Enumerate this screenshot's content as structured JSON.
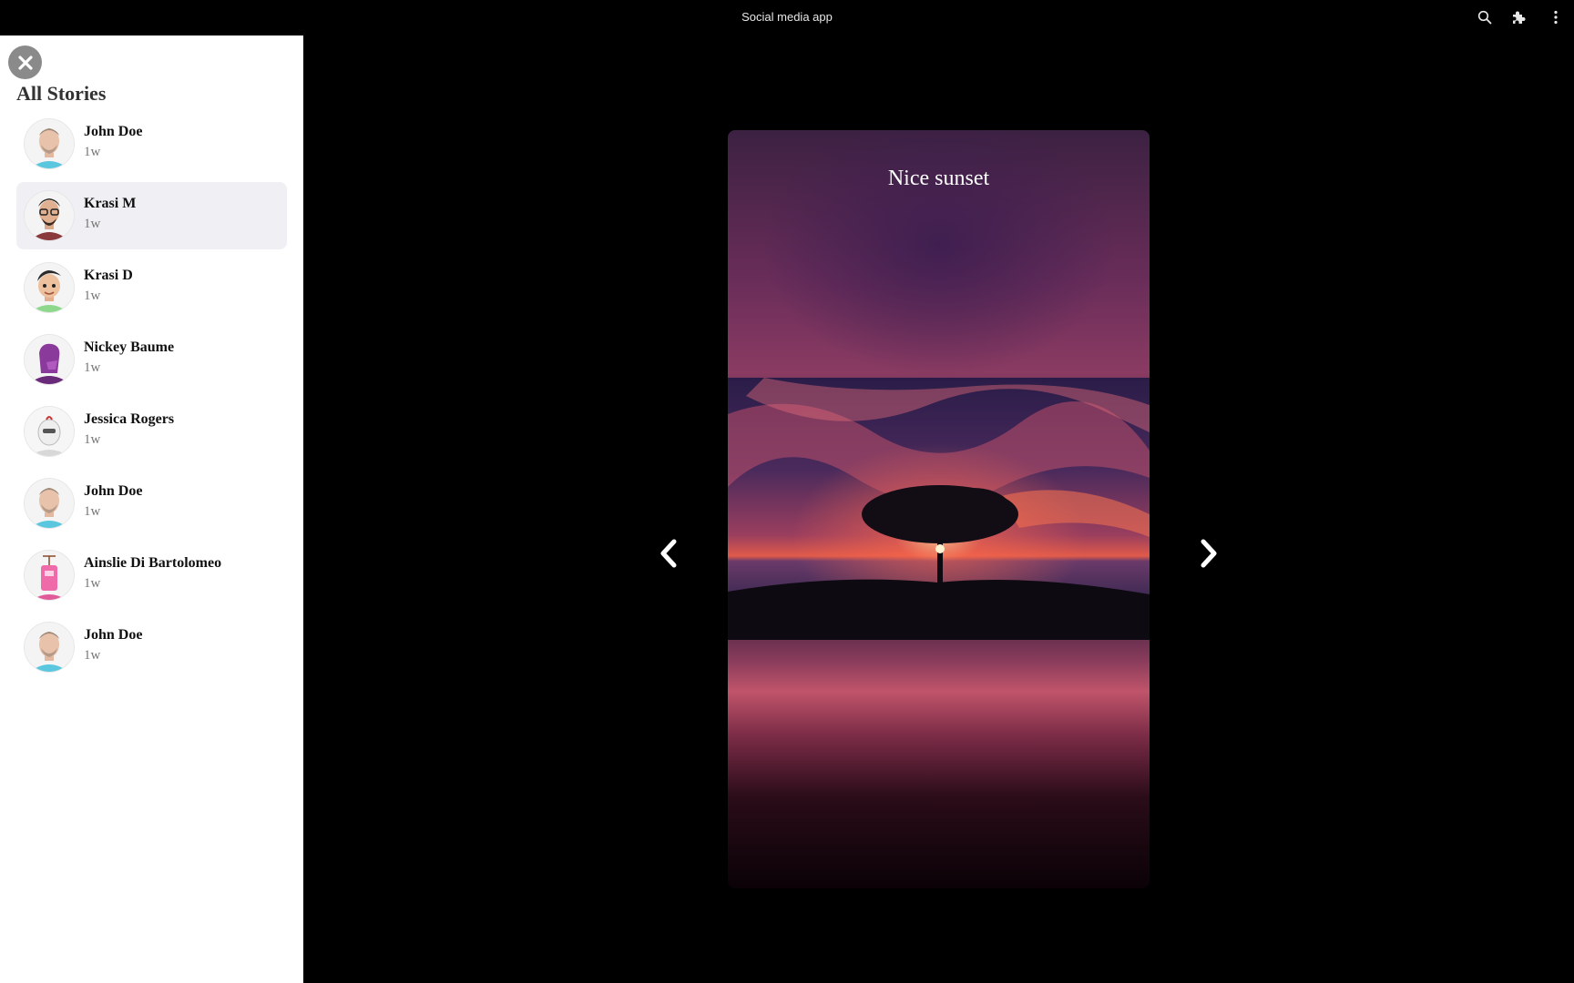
{
  "window": {
    "title": "Social media app",
    "icons": [
      "search-icon",
      "extensions-icon",
      "more-vert-icon"
    ]
  },
  "sidebar": {
    "close_icon": "close-icon",
    "heading": "All Stories",
    "stories": [
      {
        "name": "John Doe",
        "time": "1w",
        "avatar": "avatar-john-doe",
        "selected": false
      },
      {
        "name": "Krasi M",
        "time": "1w",
        "avatar": "avatar-krasi-m",
        "selected": true
      },
      {
        "name": "Krasi D",
        "time": "1w",
        "avatar": "avatar-krasi-d",
        "selected": false
      },
      {
        "name": "Nickey Baume",
        "time": "1w",
        "avatar": "avatar-nickey-baume",
        "selected": false
      },
      {
        "name": "Jessica Rogers",
        "time": "1w",
        "avatar": "avatar-jessica-rogers",
        "selected": false
      },
      {
        "name": "John Doe",
        "time": "1w",
        "avatar": "avatar-john-doe",
        "selected": false
      },
      {
        "name": "Ainslie Di Bartolomeo",
        "time": "1w",
        "avatar": "avatar-ainslie",
        "selected": false
      },
      {
        "name": "John Doe",
        "time": "1w",
        "avatar": "avatar-john-doe",
        "selected": false
      }
    ]
  },
  "viewer": {
    "caption": "Nice sunset",
    "prev_icon": "chevron-left-icon",
    "next_icon": "chevron-right-icon"
  },
  "colors": {
    "page_background": "#000000",
    "sidebar_background": "#ffffff",
    "selected_row": "#efeff4",
    "close_button": "#8a8a8a"
  }
}
